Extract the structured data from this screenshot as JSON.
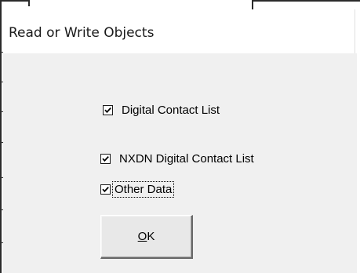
{
  "window": {
    "title": "Read or Write Objects"
  },
  "checkboxes": [
    {
      "label": "Digital Contact List",
      "checked": true
    },
    {
      "label": "NXDN Digital Contact List",
      "checked": true
    },
    {
      "label": "Other Data",
      "checked": true,
      "focused": true
    }
  ],
  "ok_button": {
    "mnemonic": "O",
    "rest": "K"
  },
  "icons": {
    "check": "checkmark-icon"
  }
}
